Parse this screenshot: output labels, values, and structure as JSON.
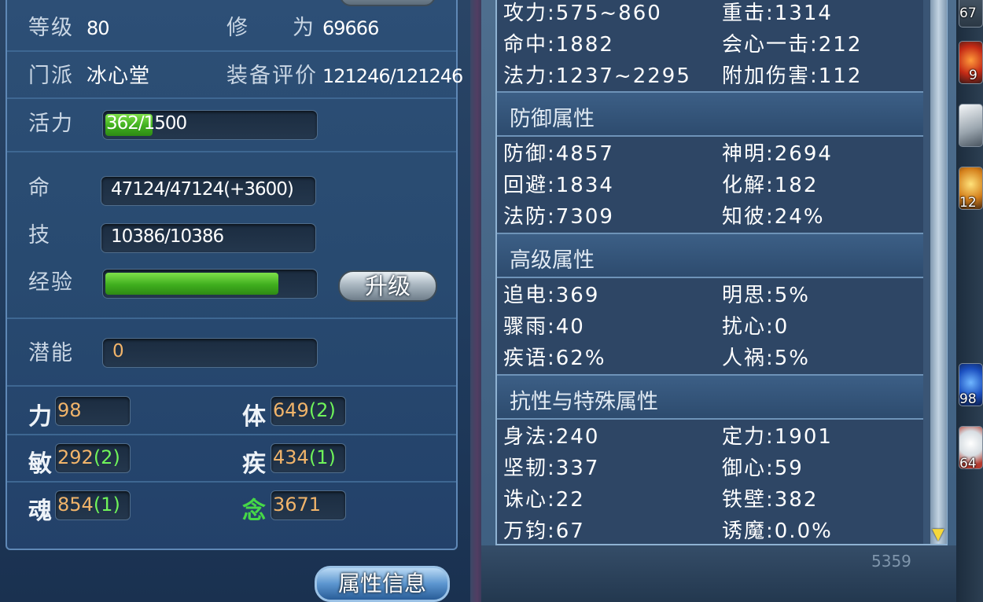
{
  "character": {
    "level_label": "等级",
    "level_value": "80",
    "cultivation_label_1": "修",
    "cultivation_label_2": "为",
    "cultivation_value": "69666",
    "sect_label": "门派",
    "sect_value": "冰心堂",
    "equip_rating_label": "装备评价",
    "equip_rating_value": "121246/121246",
    "vitality_label": "活力",
    "vitality_value": "362/1500",
    "vitality_fraction": 0.241,
    "hp_label": "命",
    "hp_value": "47124/47124(+3600)",
    "skill_label": "技",
    "skill_value": "10386/10386",
    "exp_label": "经验",
    "exp_fraction": 0.83,
    "upgrade_button": "升级",
    "potential_label": "潜能",
    "potential_value": "0"
  },
  "attributes": [
    {
      "label": "力",
      "value": "98",
      "bonus": ""
    },
    {
      "label": "体",
      "value": "649",
      "bonus": "(2)"
    },
    {
      "label": "敏",
      "value": "292",
      "bonus": "(2)"
    },
    {
      "label": "疾",
      "value": "434",
      "bonus": "(1)"
    },
    {
      "label": "魂",
      "value": "854",
      "bonus": "(1)"
    },
    {
      "label": "念",
      "value": "3671",
      "bonus": ""
    }
  ],
  "attribute_info_button": "属性信息",
  "attack_rows": [
    [
      "攻力:575~860",
      "重击:1314"
    ],
    [
      "命中:1882",
      "会心一击:212"
    ],
    [
      "法力:1237~2295",
      "附加伤害:112"
    ]
  ],
  "sections": [
    {
      "title": "防御属性",
      "rows": [
        [
          "防御:4857",
          "神明:2694"
        ],
        [
          "回避:1834",
          "化解:182"
        ],
        [
          "法防:7309",
          "知彼:24%"
        ]
      ]
    },
    {
      "title": "高级属性",
      "rows": [
        [
          "追电:369",
          "明思:5%"
        ],
        [
          "骤雨:40",
          "扰心:0"
        ],
        [
          "疾语:62%",
          "人祸:5%"
        ]
      ]
    },
    {
      "title": "抗性与特殊属性",
      "rows": [
        [
          "身法:240",
          "定力:1901"
        ],
        [
          "坚韧:337",
          "御心:59"
        ],
        [
          "诛心:22",
          "铁壁:382"
        ],
        [
          "万钧:67",
          "诱魔:0.0%"
        ]
      ]
    }
  ],
  "side_counts": [
    "67",
    "9",
    "12",
    "98",
    "64"
  ],
  "corner_number": "5359",
  "colors": {
    "attribute_value": "#f1b46a",
    "attribute_bonus": "#6ff45a",
    "bar_fill": "#4cc02a",
    "mind_label": "#46d847"
  }
}
